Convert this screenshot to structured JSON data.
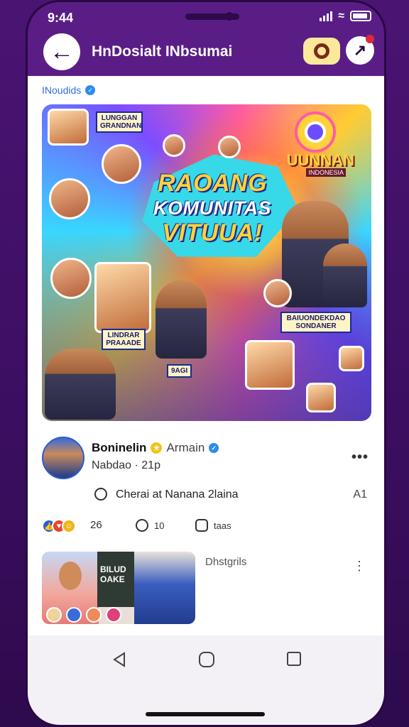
{
  "status": {
    "time": "9:44"
  },
  "header": {
    "title": "HnDosialt INbsumai",
    "back_icon": "arrow-left-icon"
  },
  "section": {
    "label": "INoudids"
  },
  "banner": {
    "headline_lines": [
      "RAOANG",
      "KOMUNITAS",
      "VITUUA!"
    ],
    "corner_title": "UUNNAN",
    "corner_subtitle": "INDONESIA",
    "tag_left": "LINDRAR\nPRAAADE",
    "tag_right": "BAIUONDEKDAO\nSONDANER",
    "tag_top_left": "LUNGGAN\nGRANDNAN",
    "small_caption": "9AGI"
  },
  "post": {
    "author": "Boninelin",
    "role": "Armain",
    "meta": "Nabdao · 21p",
    "comment": "Cherai at Nanana  2laina",
    "comment_right": "A1",
    "reactions_count": "26",
    "shares_count": "10",
    "saves_label": "taas"
  },
  "post2": {
    "title": "Dhstgrils",
    "board_text": "BILUD\nOAKE"
  },
  "colors": {
    "accent": "#2a5bd4",
    "frame": "#5a1d86",
    "background": "#3a0f5c"
  }
}
